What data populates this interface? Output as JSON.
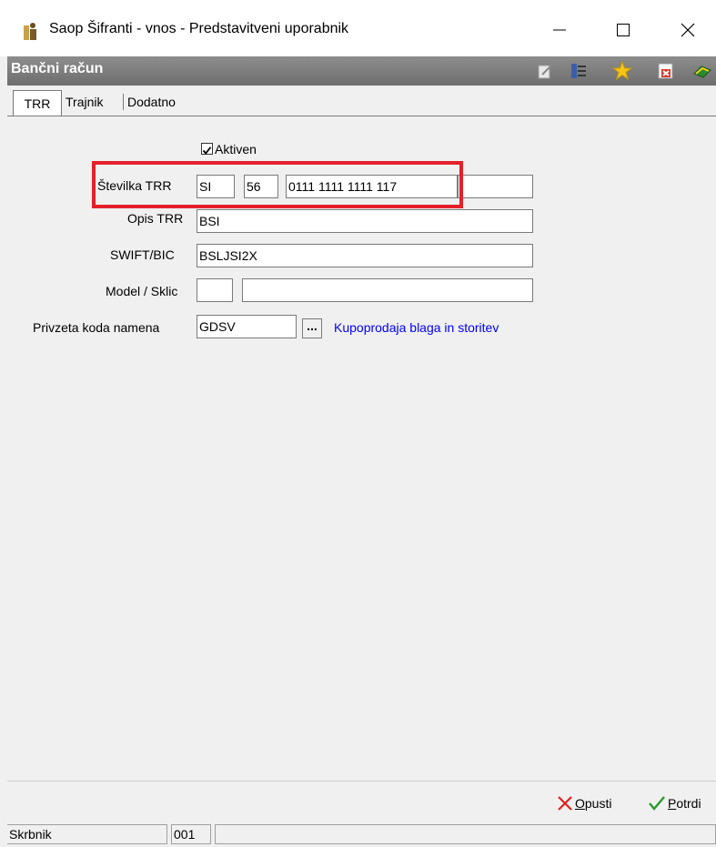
{
  "window": {
    "title": "Saop Šifranti - vnos - Predstavitveni uporabnik",
    "minimize_glyph": "—",
    "maximize_glyph": "☐",
    "close_glyph": "✕"
  },
  "header": {
    "title": "Bančni račun",
    "icons": [
      "edit-icon",
      "list-icon",
      "star-icon",
      "excel-delete-icon",
      "help-book-icon"
    ]
  },
  "tabs": [
    {
      "label": "TRR",
      "active": true
    },
    {
      "label": "Trajnik",
      "active": false
    },
    {
      "label": "Dodatno",
      "active": false
    }
  ],
  "form": {
    "active_label": "Aktiven",
    "active_checked": true,
    "trr_label": "Številka TRR",
    "trr_country": "SI",
    "trr_check": "56",
    "trr_number": "0111 1111 1111 117",
    "trr_extra": "",
    "opis_label": "Opis TRR",
    "opis_value": "BSI",
    "swift_label": "SWIFT/BIC",
    "swift_value": "BSLJSI2X",
    "model_label": "Model / Sklic",
    "model_value": "",
    "sklic_value": "",
    "namen_label": "Privzeta koda namena",
    "namen_value": "GDSV",
    "namen_button": "...",
    "namen_desc": "Kupoprodaja blaga in storitev"
  },
  "buttons": {
    "cancel_label_first": "O",
    "cancel_label_rest": "pusti",
    "confirm_label_first": "P",
    "confirm_label_rest": "otrdi"
  },
  "status": {
    "user": "Skrbnik",
    "code": "001",
    "extra": ""
  },
  "colors": {
    "header_bg": "#7d7d7d",
    "highlight": "#e4202a",
    "link": "#0000ff"
  }
}
